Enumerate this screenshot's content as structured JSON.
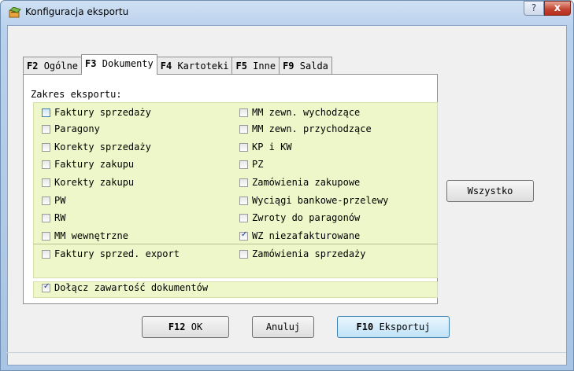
{
  "window": {
    "title": "Konfiguracja eksportu",
    "help_label": "?",
    "close_label": "x"
  },
  "tabs": [
    {
      "key": "F2",
      "label": "Ogólne",
      "active": false
    },
    {
      "key": "F3",
      "label": "Dokumenty",
      "active": true
    },
    {
      "key": "F4",
      "label": "Kartoteki",
      "active": false
    },
    {
      "key": "F5",
      "label": "Inne",
      "active": false
    },
    {
      "key": "F9",
      "label": "Salda",
      "active": false
    }
  ],
  "export_scope": {
    "label": "Zakres eksportu:",
    "left_column": [
      {
        "label": "Faktury sprzedaży",
        "checked": false
      },
      {
        "label": "Paragony",
        "checked": false
      },
      {
        "label": "Korekty sprzedaży",
        "checked": false
      },
      {
        "label": "Faktury zakupu",
        "checked": false
      },
      {
        "label": "Korekty zakupu",
        "checked": false
      },
      {
        "label": "PW",
        "checked": false
      },
      {
        "label": "RW",
        "checked": false
      },
      {
        "label": "MM wewnętrzne",
        "checked": false
      },
      {
        "label": "Faktury sprzed. export",
        "checked": false
      }
    ],
    "right_column": [
      {
        "label": "MM zewn. wychodzące",
        "checked": false
      },
      {
        "label": "MM zewn. przychodzące",
        "checked": false
      },
      {
        "label": "KP i KW",
        "checked": false
      },
      {
        "label": "PZ",
        "checked": false
      },
      {
        "label": "Zamówienia zakupowe",
        "checked": false
      },
      {
        "label": "Wyciągi bankowe-przelewy",
        "checked": false
      },
      {
        "label": "Zwroty do paragonów",
        "checked": false
      },
      {
        "label": "WZ niezafakturowane",
        "checked": true
      },
      {
        "label": "Zamówienia sprzedaży",
        "checked": false
      }
    ],
    "attach_contents": {
      "label": "Dołącz zawartość dokumentów",
      "checked": true
    },
    "select_all_label": "Wszystko"
  },
  "buttons": {
    "ok_key": "F12",
    "ok_label": "OK",
    "cancel_label": "Anuluj",
    "export_key": "F10",
    "export_label": "Eksportuj"
  },
  "colors": {
    "checkbox_area": "#eef7c9",
    "title_bar": "#b9d1ec",
    "close_button": "#c2412e"
  }
}
